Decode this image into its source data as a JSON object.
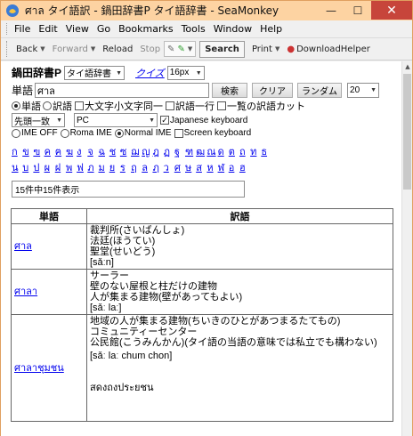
{
  "window": {
    "title": "ศาล タイ語訳 - 鍋田辞書P タイ語辞書 - SeaMonkey",
    "controls": {
      "minimize": "—",
      "maximize": "☐",
      "close": "✕"
    }
  },
  "menu": [
    "File",
    "Edit",
    "View",
    "Go",
    "Bookmarks",
    "Tools",
    "Window",
    "Help"
  ],
  "nav": {
    "back": "Back",
    "forward": "Forward",
    "reload": "Reload",
    "stop": "Stop",
    "search": "Search",
    "print": "Print",
    "download": "DownloadHelper"
  },
  "form": {
    "brand": "鍋田辞書P",
    "dict_select": "タイ語辞書",
    "quiz_link": "クイズ",
    "font_select": "16px",
    "word_label": "単語",
    "word_value": "ศาล",
    "search_btn": "検索",
    "clear_btn": "クリア",
    "random_btn": "ランダム",
    "count_select": "20",
    "opt_word": "単語",
    "opt_trans": "訳語",
    "opt_case": "大文字小文字同一",
    "opt_oneline": "訳語一行",
    "opt_cut": "一覧の訳語カット",
    "match_select": "先頭一致",
    "kbd_select": "PC",
    "jp_kbd_label": "Japanese keyboard",
    "ime_off": "IME OFF",
    "roma_ime": "Roma IME",
    "normal_ime": "Normal IME",
    "screen_kbd": "Screen keyboard",
    "thai_row1": [
      "ก",
      "ข",
      "ฃ",
      "ค",
      "ฅ",
      "ฆ",
      "ง",
      "จ",
      "ฉ",
      "ช",
      "ซ",
      "ฌ",
      "ญ",
      "ฎ",
      "ฏ",
      "ฐ",
      "ฑ",
      "ฒ",
      "ณ",
      "ด",
      "ต",
      "ถ",
      "ท",
      "ธ"
    ],
    "thai_row2": [
      "น",
      "บ",
      "ป",
      "ผ",
      "ฝ",
      "พ",
      "ฟ",
      "ภ",
      "ม",
      "ย",
      "ร",
      "ฤ",
      "ล",
      "ฦ",
      "ว",
      "ศ",
      "ษ",
      "ส",
      "ห",
      "ฬ",
      "อ",
      "ฮ"
    ],
    "result_count": "15件中15件表示"
  },
  "table": {
    "headers": [
      "単語",
      "訳語"
    ],
    "rows": [
      {
        "word": "ศาล",
        "lines": [
          "裁判所(さいばんしょ)",
          "法廷(ほうてい)",
          "聖堂(せいどう)"
        ],
        "pron": "[sǎːn]"
      },
      {
        "word": "ศาลา",
        "lines": [
          "サーラー",
          "壁のない屋根と柱だけの建物",
          "人が集まる建物(壁があってもよい)"
        ],
        "pron": "[sǎː laː]"
      },
      {
        "word": "ศาลาชุมชน",
        "lines": [
          "地域の人が集まる建物(ちいきのひとがあつまるたてもの)",
          "コミュニティーセンター",
          "公民館(こうみんかん)(タイ語の当語の意味では私立でも構わない)"
        ],
        "pron": "[sǎː laː chum chon]",
        "extra": "สดงถงประยชน"
      }
    ]
  }
}
